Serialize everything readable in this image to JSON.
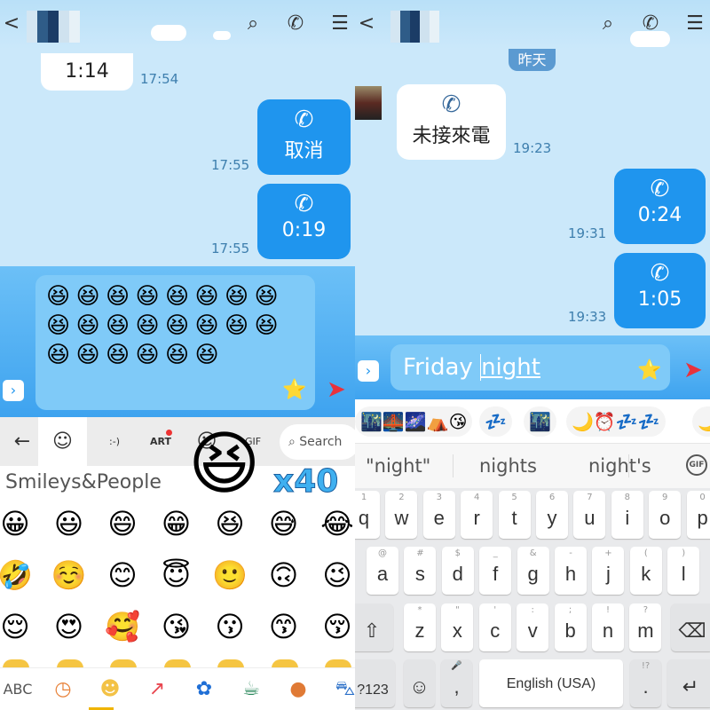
{
  "left": {
    "chat": {
      "messages": [
        {
          "type": "received",
          "text": "1:14",
          "time": "17:54"
        },
        {
          "type": "sent",
          "icon": "phone-icon",
          "text": "取消",
          "time": "17:55"
        },
        {
          "type": "sent",
          "icon": "phone-ring-icon",
          "text": "0:19",
          "time": "17:55"
        }
      ]
    },
    "input": {
      "emoji": "😆",
      "emoji_count": 22
    },
    "keyboard": {
      "tabs": [
        {
          "icon": "back-arrow-icon",
          "label": "←"
        },
        {
          "icon": "smiley-icon",
          "label": "☺"
        },
        {
          "icon": "emoticon-icon",
          "label": ":-)"
        },
        {
          "icon": "art-icon",
          "label": "ART"
        },
        {
          "icon": "sticker-icon",
          "label": "☺"
        },
        {
          "icon": "gif-icon",
          "label": "GIF"
        }
      ],
      "search_label": "Search",
      "overlay": {
        "emoji": "😆",
        "count": "x40"
      },
      "category_title": "Smileys&People",
      "emojis": [
        "😀",
        "😃",
        "😄",
        "😁",
        "😆",
        "😅",
        "😂",
        "🤣",
        "☺️",
        "😊",
        "😇",
        "🙂",
        "🙃",
        "😉",
        "😌",
        "😍",
        "🥰",
        "😘",
        "😗",
        "😙",
        "😚"
      ],
      "bottom": [
        {
          "label": "ABC"
        },
        {
          "icon": "clock-icon",
          "label": "◷",
          "color": "#e8823a"
        },
        {
          "icon": "smiley-icon",
          "label": "☻",
          "color": "#f3c246"
        },
        {
          "icon": "trending-icon",
          "label": "↗",
          "color": "#e8464f"
        },
        {
          "icon": "flower-icon",
          "label": "✿",
          "color": "#1f6fd6"
        },
        {
          "icon": "coffee-icon",
          "label": "☕",
          "color": "#2e8a5e"
        },
        {
          "icon": "basketball-icon",
          "label": "●",
          "color": "#e07a35"
        },
        {
          "icon": "car-icon",
          "label": "⛍",
          "color": "#2a6fc8"
        },
        {
          "icon": "backspace-icon",
          "label": "⌫",
          "color": "#555"
        }
      ]
    }
  },
  "right": {
    "chat": {
      "date_label": "昨天",
      "messages": [
        {
          "type": "received",
          "icon": "phone-icon",
          "text": "未接來電",
          "time": "19:23"
        },
        {
          "type": "sent",
          "icon": "phone-ring-icon",
          "text": "0:24",
          "time": "19:31"
        },
        {
          "type": "sent",
          "icon": "phone-ring-icon",
          "text": "1:05",
          "time": "19:33"
        }
      ]
    },
    "input": {
      "text_before": "Friday ",
      "text_underlined": "night"
    },
    "emoji_suggestions": [
      "🌃🌉🌌⛺😘",
      "💤",
      "🌃",
      "🌙⏰💤💤",
      "🌙"
    ],
    "word_suggestions": [
      "\"night\"",
      "nights",
      "night's"
    ],
    "keyboard": {
      "row1": [
        [
          "q",
          "1"
        ],
        [
          "w",
          "2"
        ],
        [
          "e",
          "3"
        ],
        [
          "r",
          "4"
        ],
        [
          "t",
          "5"
        ],
        [
          "y",
          "6"
        ],
        [
          "u",
          "7"
        ],
        [
          "i",
          "8"
        ],
        [
          "o",
          "9"
        ],
        [
          "p",
          "0"
        ]
      ],
      "row2": [
        [
          "a",
          "@"
        ],
        [
          "s",
          "#"
        ],
        [
          "d",
          "$"
        ],
        [
          "f",
          "_"
        ],
        [
          "g",
          "&"
        ],
        [
          "h",
          "-"
        ],
        [
          "j",
          "+"
        ],
        [
          "k",
          "("
        ],
        [
          "l",
          ")"
        ]
      ],
      "row3": [
        [
          "z",
          "*"
        ],
        [
          "x",
          "\""
        ],
        [
          "c",
          "'"
        ],
        [
          "v",
          ":"
        ],
        [
          "b",
          ";"
        ],
        [
          "n",
          "!"
        ],
        [
          "m",
          "?"
        ]
      ],
      "symbols_label": "?123",
      "comma": ",",
      "period": ".",
      "period_sub": "!?",
      "space_label": "English (USA)"
    }
  },
  "colors": {
    "bubble_blue": "#1f95ee",
    "chat_bg": "#cbe8fa",
    "send": "#e8323c"
  }
}
